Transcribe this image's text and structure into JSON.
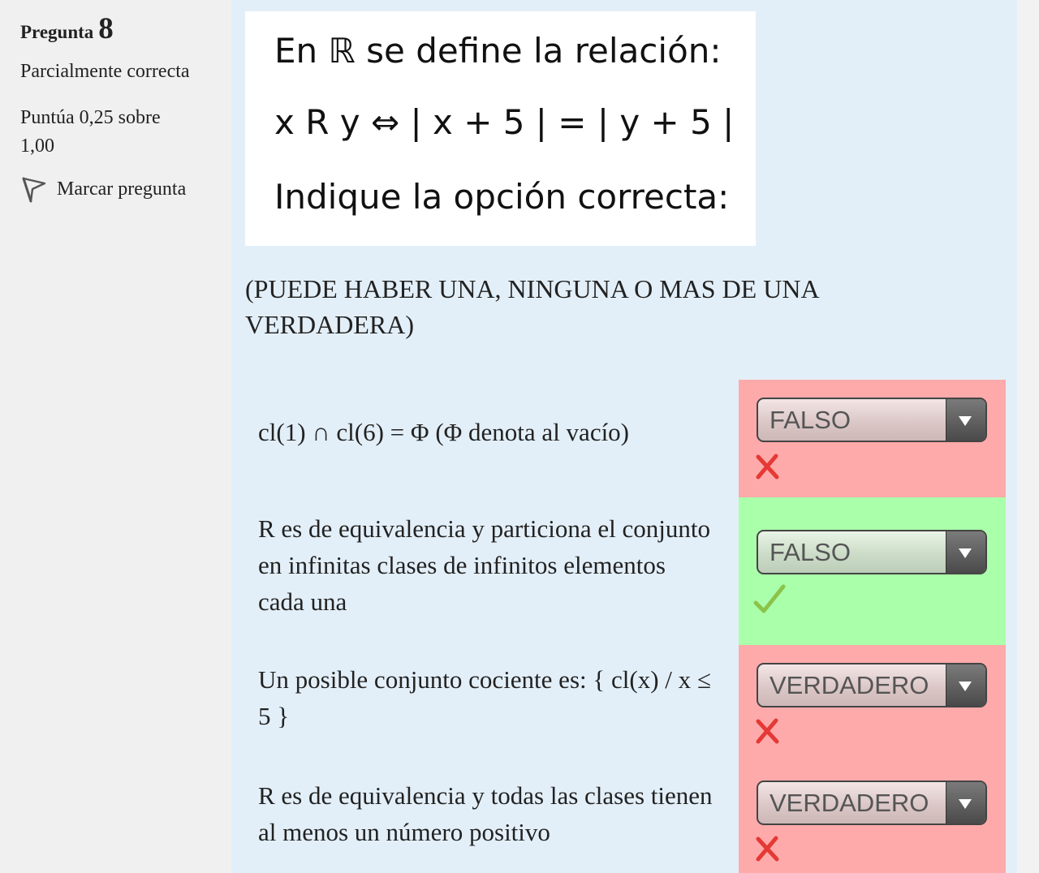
{
  "info": {
    "question_label": "Pregunta",
    "question_number": "8",
    "state": "Parcialmente correcta",
    "grade": "Puntúa 0,25 sobre 1,00",
    "flag_label": "Marcar pregunta"
  },
  "question_image": {
    "line1": "En ℝ se define la relación:",
    "line2": "x R y ⇔ | x + 5 | = | y + 5 |",
    "line3": "Indique la opción correcta:"
  },
  "instruction": "(PUEDE HABER UNA, NINGUNA O MAS DE UNA VERDADERA)",
  "statements": [
    {
      "text": "cl(1) ∩ cl(6) = Φ  (Φ denota al vacío)",
      "selected": "FALSO",
      "result": "incorrect"
    },
    {
      "text": "R es de equivalencia y particiona el conjunto en infinitas clases de infinitos elementos cada una",
      "selected": "FALSO",
      "result": "correct"
    },
    {
      "text": "Un posible conjunto cociente es:  { cl(x) / x ≤ 5 }",
      "selected": "VERDADERO",
      "result": "incorrect"
    },
    {
      "text": "R es de equivalencia y todas las clases tienen al menos un número positivo",
      "selected": "VERDADERO",
      "result": "incorrect"
    }
  ],
  "colors": {
    "content_bg": "#e3eff8",
    "incorrect_bg": "#ffaaaa",
    "correct_bg": "#aaffaa",
    "incorrect_icon": "#e53935",
    "correct_icon": "#8bc34a"
  },
  "icons": {
    "flag": "flag-icon",
    "incorrect": "cross-icon",
    "correct": "check-icon"
  }
}
